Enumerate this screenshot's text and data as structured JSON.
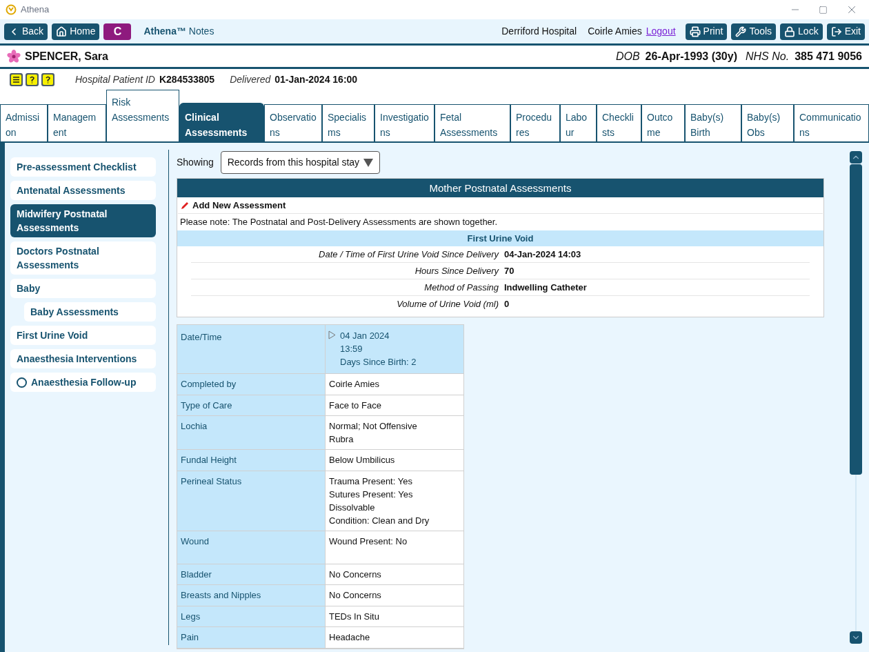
{
  "window": {
    "title": "Athena"
  },
  "toolbar": {
    "buttons": [
      {
        "kind": "back",
        "label": "Back"
      },
      {
        "kind": "home",
        "label": "Home"
      },
      {
        "kind": "badge",
        "label": "C"
      }
    ],
    "app_name": "Athena™",
    "app_sub": "Notes",
    "hospital": "Derriford Hospital",
    "user": "Coirle Amies",
    "logout": "Logout",
    "actions": [
      {
        "kind": "print",
        "label": "Print"
      },
      {
        "kind": "tools",
        "label": "Tools"
      },
      {
        "kind": "lock",
        "label": "Lock"
      },
      {
        "kind": "exit",
        "label": "Exit"
      }
    ]
  },
  "patient": {
    "name": "SPENCER, Sara",
    "dob_label": "DOB",
    "dob": "26-Apr-1993 (30y)",
    "nhs_label": "NHS No.",
    "nhs": "385 471 9056",
    "id_label": "Hospital Patient ID",
    "id": "K284533805",
    "delivered_label": "Delivered",
    "delivered": "01-Jan-2024 16:00"
  },
  "tabs": [
    {
      "label": "Admission",
      "selected": false
    },
    {
      "label": "Management",
      "selected": false
    },
    {
      "label": "Risk Assessments",
      "selected": false,
      "raised": true
    },
    {
      "label": "Clinical Assessments",
      "selected": true
    },
    {
      "label": "Observations",
      "selected": false
    },
    {
      "label": "Specialisms",
      "selected": false
    },
    {
      "label": "Investigations",
      "selected": false
    },
    {
      "label": "Fetal Assessments",
      "selected": false
    },
    {
      "label": "Procedures",
      "selected": false
    },
    {
      "label": "Labour",
      "selected": false
    },
    {
      "label": "Checklists",
      "selected": false
    },
    {
      "label": "Outcome",
      "selected": false
    },
    {
      "label": "Baby(s) Birth",
      "selected": false
    },
    {
      "label": "Baby(s) Obs",
      "selected": false
    },
    {
      "label": "Communications",
      "selected": false
    }
  ],
  "sidebar": {
    "items": [
      {
        "label": "Pre-assessment Checklist",
        "selected": false,
        "kind": "item"
      },
      {
        "label": "Antenatal Assessments",
        "selected": false,
        "kind": "item"
      },
      {
        "label": "Midwifery Postnatal Assessments",
        "selected": true,
        "kind": "item"
      },
      {
        "label": "Doctors Postnatal Assessments",
        "selected": false,
        "kind": "item"
      },
      {
        "label": "Baby",
        "selected": false,
        "kind": "item",
        "children": [
          {
            "label": "Baby Assessments",
            "selected": false,
            "kind": "sub"
          }
        ]
      },
      {
        "label": "First Urine Void",
        "selected": false,
        "kind": "item"
      },
      {
        "label": "Anaesthesia Interventions",
        "selected": false,
        "kind": "item"
      },
      {
        "label": "Anaesthesia Follow-up",
        "selected": false,
        "kind": "radio",
        "checked": false
      }
    ]
  },
  "filter": {
    "label": "Showing",
    "value": "Records from this hospital stay"
  },
  "panel": {
    "title": "Mother Postnatal Assessments",
    "add": "Add New Assessment",
    "note": "Please note:  The Postnatal and Post-Delivery Assessments are shown together.",
    "section": "First Urine Void",
    "fields": [
      {
        "label": "Date / Time of First Urine Void Since Delivery",
        "value": "04-Jan-2024 14:03"
      },
      {
        "label": "Hours Since Delivery",
        "value": "70"
      },
      {
        "label": "Method of Passing",
        "value": "Indwelling Catheter"
      },
      {
        "label": "Volume of Urine Void (ml)",
        "value": "0"
      }
    ]
  },
  "record": {
    "header_label": "Date/Time",
    "header_lines": [
      "04 Jan 2024",
      "13:59",
      "Days Since Birth: 2"
    ],
    "expanded": false,
    "rows": [
      {
        "label": "Completed by",
        "lines": [
          "Coirle Amies"
        ]
      },
      {
        "label": "Type of Care",
        "lines": [
          "Face to Face"
        ]
      },
      {
        "label": "Lochia",
        "lines": [
          "Normal; Not Offensive",
          "Rubra"
        ]
      },
      {
        "label": "Fundal Height",
        "lines": [
          "Below Umbilicus"
        ]
      },
      {
        "label": "Perineal Status",
        "lines": [
          "Trauma Present: Yes",
          "Sutures Present: Yes",
          "Dissolvable",
          "Condition: Clean and Dry"
        ]
      },
      {
        "label": "Wound",
        "lines": [
          "Wound Present: No"
        ],
        "tall": true
      },
      {
        "label": "Bladder",
        "lines": [
          "No Concerns"
        ]
      },
      {
        "label": "Breasts and Nipples",
        "lines": [
          "No Concerns"
        ]
      },
      {
        "label": "Legs",
        "lines": [
          "TEDs In Situ"
        ]
      },
      {
        "label": "Pain",
        "lines": [
          "Headache"
        ]
      }
    ]
  }
}
